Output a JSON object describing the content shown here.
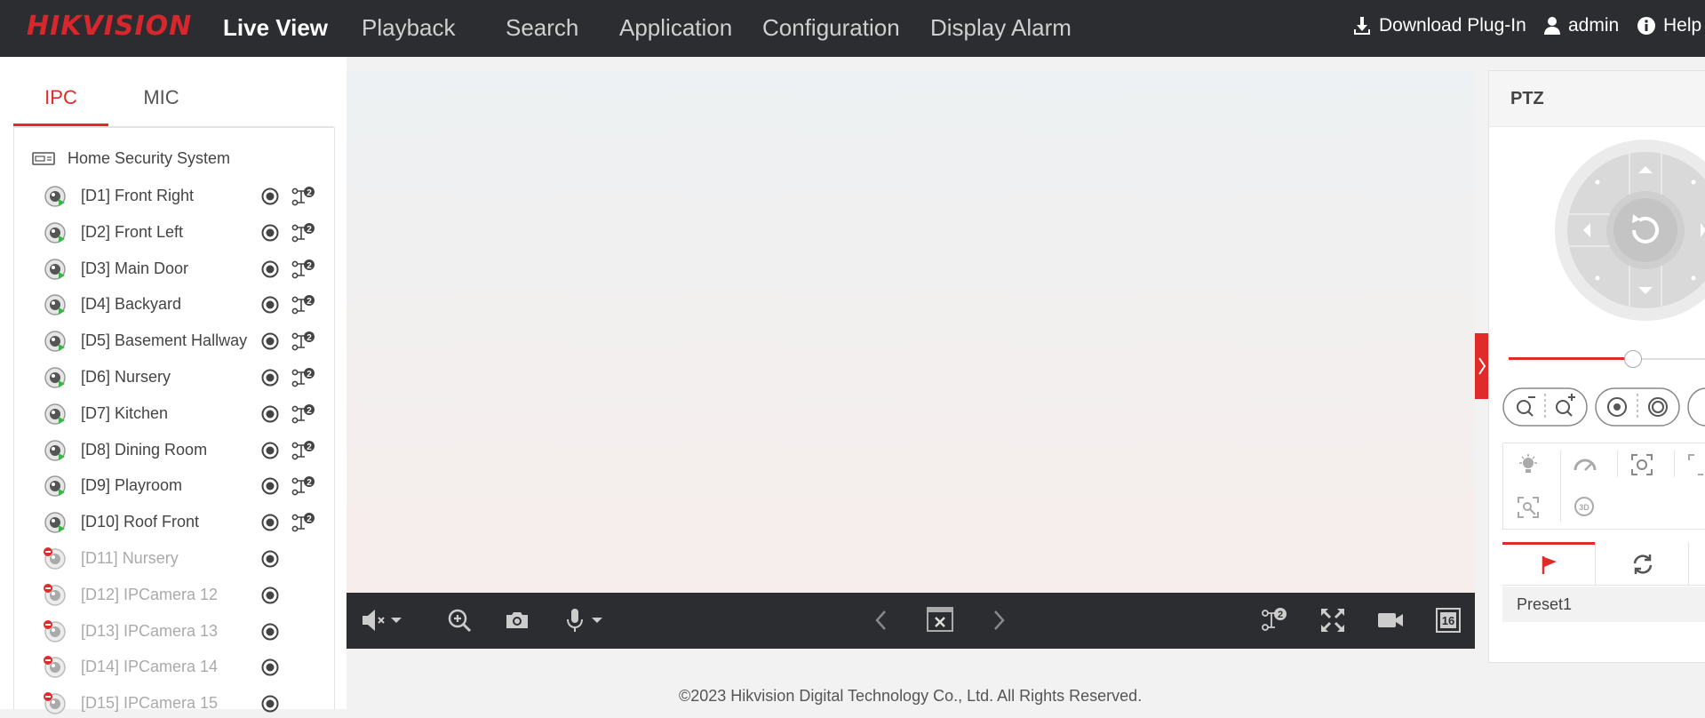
{
  "header": {
    "logo_text": "HIKVISION",
    "nav": [
      "Live View",
      "Playback",
      "Search",
      "Application",
      "Configuration",
      "Display Alarm"
    ],
    "download_label": "Download Plug-In",
    "user_label": "admin",
    "help_label": "Help"
  },
  "left_panel": {
    "tabs": [
      "IPC",
      "MIC"
    ],
    "root_label": "Home Security System",
    "cameras": [
      {
        "label": "[D1] Front Right",
        "online": true
      },
      {
        "label": "[D2] Front Left",
        "online": true
      },
      {
        "label": "[D3] Main Door",
        "online": true
      },
      {
        "label": "[D4] Backyard",
        "online": true
      },
      {
        "label": "[D5] Basement Hallway",
        "online": true
      },
      {
        "label": "[D6] Nursery",
        "online": true
      },
      {
        "label": "[D7] Kitchen",
        "online": true
      },
      {
        "label": "[D8] Dining Room",
        "online": true
      },
      {
        "label": "[D9] Playroom",
        "online": true
      },
      {
        "label": "[D10] Roof Front",
        "online": true
      },
      {
        "label": "[D11] Nursery",
        "online": false
      },
      {
        "label": "[D12] IPCamera 12",
        "online": false
      },
      {
        "label": "[D13] IPCamera 13",
        "online": false
      },
      {
        "label": "[D14] IPCamera 14",
        "online": false
      },
      {
        "label": "[D15] IPCamera 15",
        "online": false
      }
    ],
    "stream_badge": "2"
  },
  "video_toolbar": {
    "layout_badge": "16",
    "stream_badge": "2"
  },
  "footer": {
    "copyright": "©2023 Hikvision Digital Technology Co., Ltd. All Rights Reserved."
  },
  "ptz": {
    "title": "PTZ",
    "speed_fraction": 0.63,
    "preset_label": "Preset1"
  },
  "colors": {
    "accent": "#e12a2a",
    "topbar": "#2b2d30",
    "online": "#3cb44b"
  }
}
